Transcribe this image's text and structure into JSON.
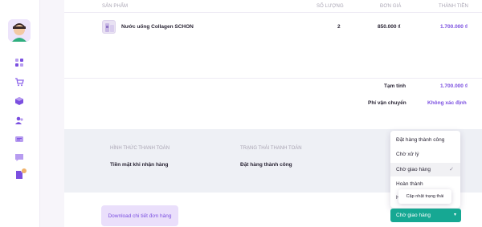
{
  "table": {
    "headers": {
      "product": "SẢN PHẨM",
      "quantity": "SỐ LƯỢNG",
      "unit_price": "ĐƠN GIÁ",
      "line_total": "THÀNH TIỀN"
    },
    "rows": [
      {
        "product": "Nước uống Collagen SCHON",
        "quantity": "2",
        "unit_price": "850.000 ₫",
        "line_total": "1.700.000 ₫"
      }
    ]
  },
  "summary": {
    "subtotal_label": "Tạm tính",
    "subtotal_value": "1.700.000 ₫",
    "shipping_label": "Phí vận chuyển",
    "shipping_value": "Không xác định"
  },
  "info": {
    "payment_head": "HÌNH THỨC THANH TOÁN",
    "payment_value": "Tiền mặt khi nhận hàng",
    "status_head": "TRẠNG THÁI THANH TOÁN",
    "status_value": "Đặt hàng thành công"
  },
  "dropdown": {
    "options": [
      "Đặt hàng thành công",
      "Chờ xử lý",
      "Chờ giao hàng",
      "Hoàn thành",
      "H"
    ],
    "selected_index": 2,
    "check_icon": "✓"
  },
  "tooltip": "Cập nhật trạng thái",
  "status_select": {
    "value": "Chờ giao hàng",
    "caret": "▾"
  },
  "download_button": "Download chi tiết đơn hàng",
  "colors": {
    "accent": "#7b4fe0",
    "status_select": "#16a893",
    "band": "#eef0f5"
  },
  "icons": [
    "dashboard-icon",
    "cart-icon",
    "box-icon",
    "users-icon",
    "message-icon",
    "chat-icon",
    "document-icon"
  ]
}
